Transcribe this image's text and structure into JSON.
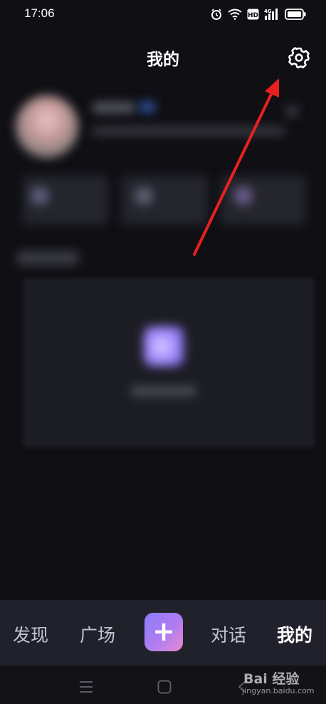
{
  "status_bar": {
    "time": "17:06"
  },
  "header": {
    "title": "我的"
  },
  "nav": {
    "discover": "发现",
    "square": "广场",
    "create": "+",
    "chat": "对话",
    "me": "我的"
  },
  "watermark": {
    "brand": "Bai 经验",
    "url": "jingyan.baidu.com"
  },
  "colors": {
    "accent_gradient_start": "#8b7cff",
    "accent_gradient_end": "#e88bd2",
    "arrow": "#e8201f",
    "background": "#0f0f14"
  }
}
